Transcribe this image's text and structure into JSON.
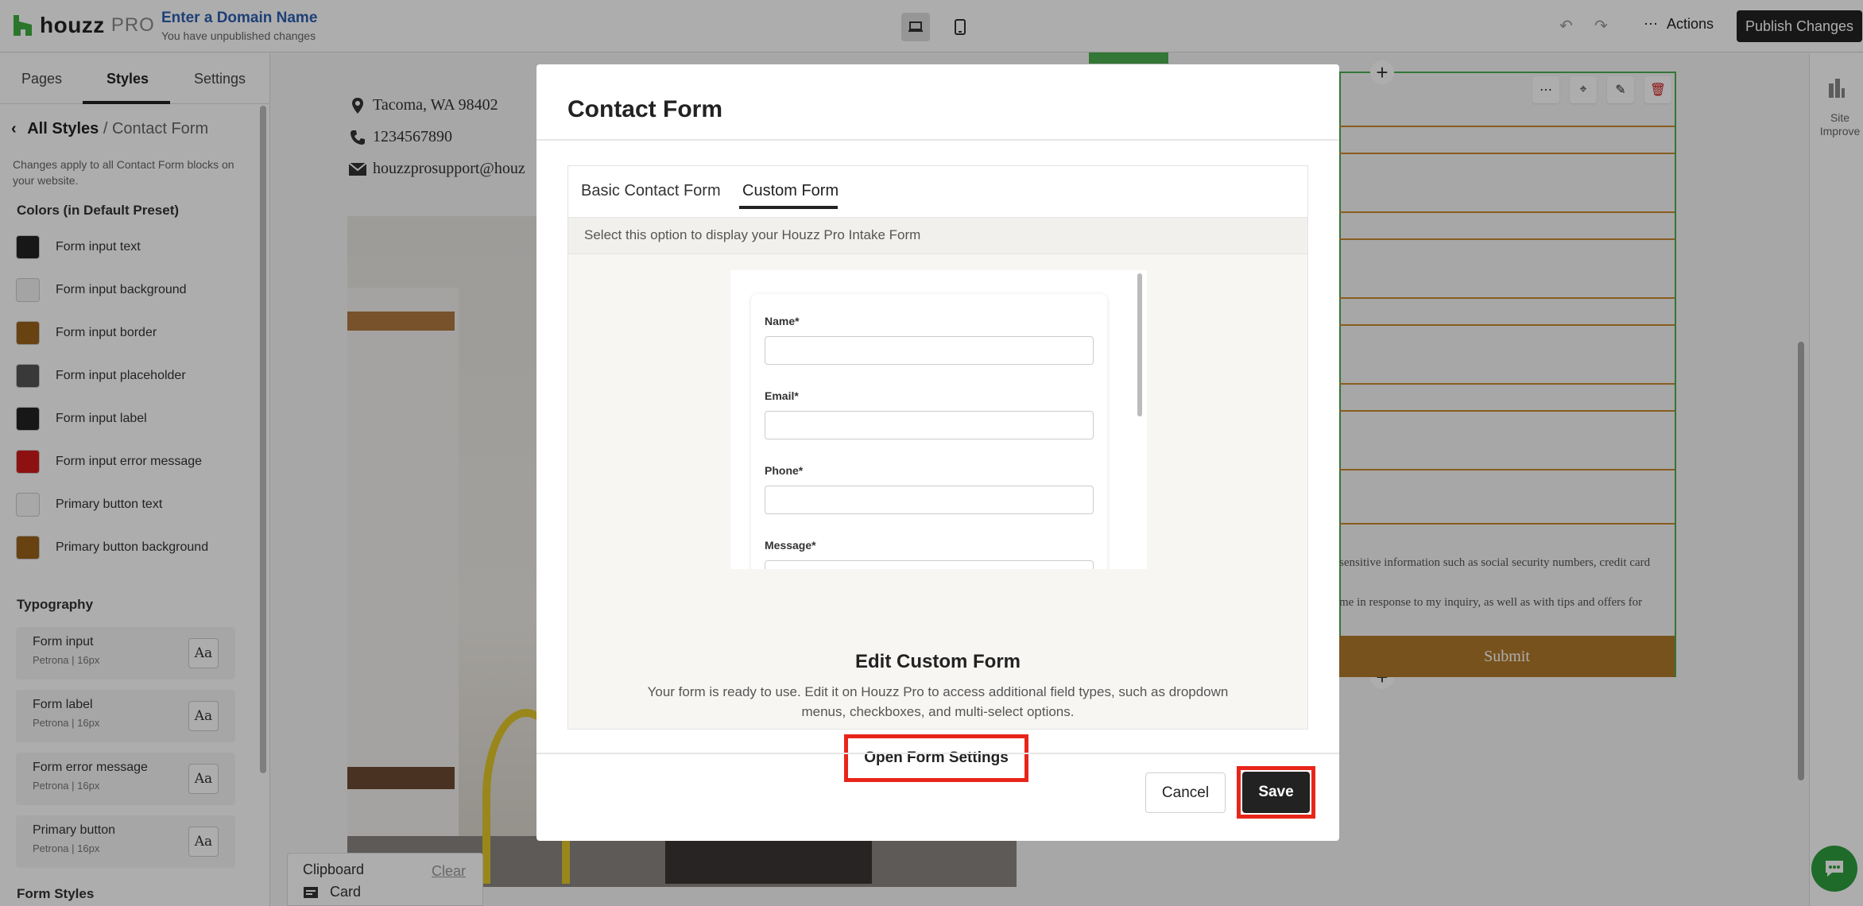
{
  "topbar": {
    "logo_word": "houzz",
    "logo_pro": "PRO",
    "domain_link": "Enter a Domain Name",
    "domain_sub": "You have unpublished changes",
    "actions_label": "Actions",
    "publish_label": "Publish Changes"
  },
  "sidebar": {
    "tabs": [
      "Pages",
      "Styles",
      "Settings"
    ],
    "active_tab": "Styles",
    "crumb_root": "All Styles",
    "crumb_sep": "/",
    "crumb_leaf": "Contact Form",
    "hint": "Changes apply to all Contact Form blocks on your website.",
    "colors_title": "Colors (in Default Preset)",
    "colors": [
      {
        "label": "Form input text",
        "color": "#222222"
      },
      {
        "label": "Form input background",
        "color": "#f2f2f2"
      },
      {
        "label": "Form input border",
        "color": "#9a6218"
      },
      {
        "label": "Form input placeholder",
        "color": "#555555"
      },
      {
        "label": "Form input label",
        "color": "#222222"
      },
      {
        "label": "Form input error message",
        "color": "#d11a1a"
      },
      {
        "label": "Primary button text",
        "color": "#f8f8f8"
      },
      {
        "label": "Primary button background",
        "color": "#9a6218"
      }
    ],
    "typography_title": "Typography",
    "typography": [
      {
        "name": "Form input",
        "meta": "Petrona | 16px"
      },
      {
        "name": "Form label",
        "meta": "Petrona | 16px"
      },
      {
        "name": "Form error message",
        "meta": "Petrona | 16px"
      },
      {
        "name": "Primary button",
        "meta": "Petrona | 16px"
      }
    ],
    "aa_label": "Aa",
    "form_styles_title": "Form Styles"
  },
  "canvas": {
    "address": "Tacoma, WA 98402",
    "phone": "1234567890",
    "email": "houzzprosupport@houz",
    "disclaimer1": "sensitive information such as social security numbers, credit card",
    "disclaimer2": "me in response to my inquiry, as well as with tips and offers for",
    "submit_label": "Submit",
    "rail_label": "Site Improve"
  },
  "clipboard": {
    "title": "Clipboard",
    "clear": "Clear",
    "item": "Card"
  },
  "modal": {
    "title": "Contact Form",
    "tabs": [
      "Basic Contact Form",
      "Custom Form"
    ],
    "active_tab": "Custom Form",
    "hint": "Select this option to display your Houzz Pro Intake Form",
    "preview_fields": [
      "Name*",
      "Email*",
      "Phone*",
      "Message*"
    ],
    "edit_title": "Edit Custom Form",
    "edit_desc": "Your form is ready to use. Edit it on Houzz Pro to access additional field types, such as dropdown menus, checkboxes, and multi-select options.",
    "open_settings_label": "Open Form Settings",
    "cancel_label": "Cancel",
    "save_label": "Save"
  },
  "colors": {
    "accent_highlight": "#e8251a",
    "brand_green": "#4caf50",
    "link_blue": "#2d5fb0"
  }
}
